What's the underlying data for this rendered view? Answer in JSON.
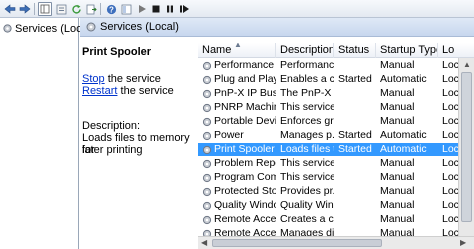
{
  "toolbar": {
    "buttons": [
      "back-arrow-icon",
      "forward-arrow-icon",
      "console-tree-icon",
      "properties-icon",
      "refresh-icon",
      "export-list-icon",
      "help-icon",
      "show-hide-icon",
      "start-icon",
      "stop-icon",
      "pause-icon",
      "restart-icon"
    ]
  },
  "tree": {
    "root_label": "Services (Local)"
  },
  "header": {
    "title": "Services (Local)"
  },
  "details": {
    "service_name": "Print Spooler",
    "stop_link": "Stop",
    "stop_suffix": " the service",
    "restart_link": "Restart",
    "restart_suffix": " the service",
    "description_label": "Description:",
    "description_line1": "Loads files to memory for",
    "description_line2": "later printing"
  },
  "list": {
    "columns": [
      "Name",
      "Description",
      "Status",
      "Startup Type",
      "Lo"
    ],
    "rows": [
      {
        "name": "Performance L...",
        "description": "Performanc...",
        "status": "",
        "startup": "Manual",
        "log": "Loc"
      },
      {
        "name": "Plug and Play",
        "description": "Enables a c...",
        "status": "Started",
        "startup": "Automatic",
        "log": "Loc"
      },
      {
        "name": "PnP-X IP Bus E...",
        "description": "The PnP-X ...",
        "status": "",
        "startup": "Manual",
        "log": "Loc"
      },
      {
        "name": "PNRP Machine...",
        "description": "This service ...",
        "status": "",
        "startup": "Manual",
        "log": "Loc"
      },
      {
        "name": "Portable Devic...",
        "description": "Enforces gr...",
        "status": "",
        "startup": "Manual",
        "log": "Loc"
      },
      {
        "name": "Power",
        "description": "Manages p...",
        "status": "Started",
        "startup": "Automatic",
        "log": "Loc"
      },
      {
        "name": "Print Spooler",
        "description": "Loads files t...",
        "status": "Started",
        "startup": "Automatic",
        "log": "Loc",
        "selected": true
      },
      {
        "name": "Problem Repo...",
        "description": "This service ...",
        "status": "",
        "startup": "Manual",
        "log": "Loc"
      },
      {
        "name": "Program Com...",
        "description": "This service ...",
        "status": "",
        "startup": "Manual",
        "log": "Loc"
      },
      {
        "name": "Protected Stor...",
        "description": "Provides pr...",
        "status": "",
        "startup": "Manual",
        "log": "Loc"
      },
      {
        "name": "Quality Windo...",
        "description": "Quality Win...",
        "status": "",
        "startup": "Manual",
        "log": "Loc"
      },
      {
        "name": "Remote Acces...",
        "description": "Creates a c...",
        "status": "",
        "startup": "Manual",
        "log": "Loc"
      },
      {
        "name": "Remote Acces...",
        "description": "Manages di...",
        "status": "",
        "startup": "Manual",
        "log": "Loc"
      }
    ]
  },
  "colors": {
    "selection": "#3399ff",
    "link": "#0033cc",
    "header_band": "#c7d7ee"
  }
}
